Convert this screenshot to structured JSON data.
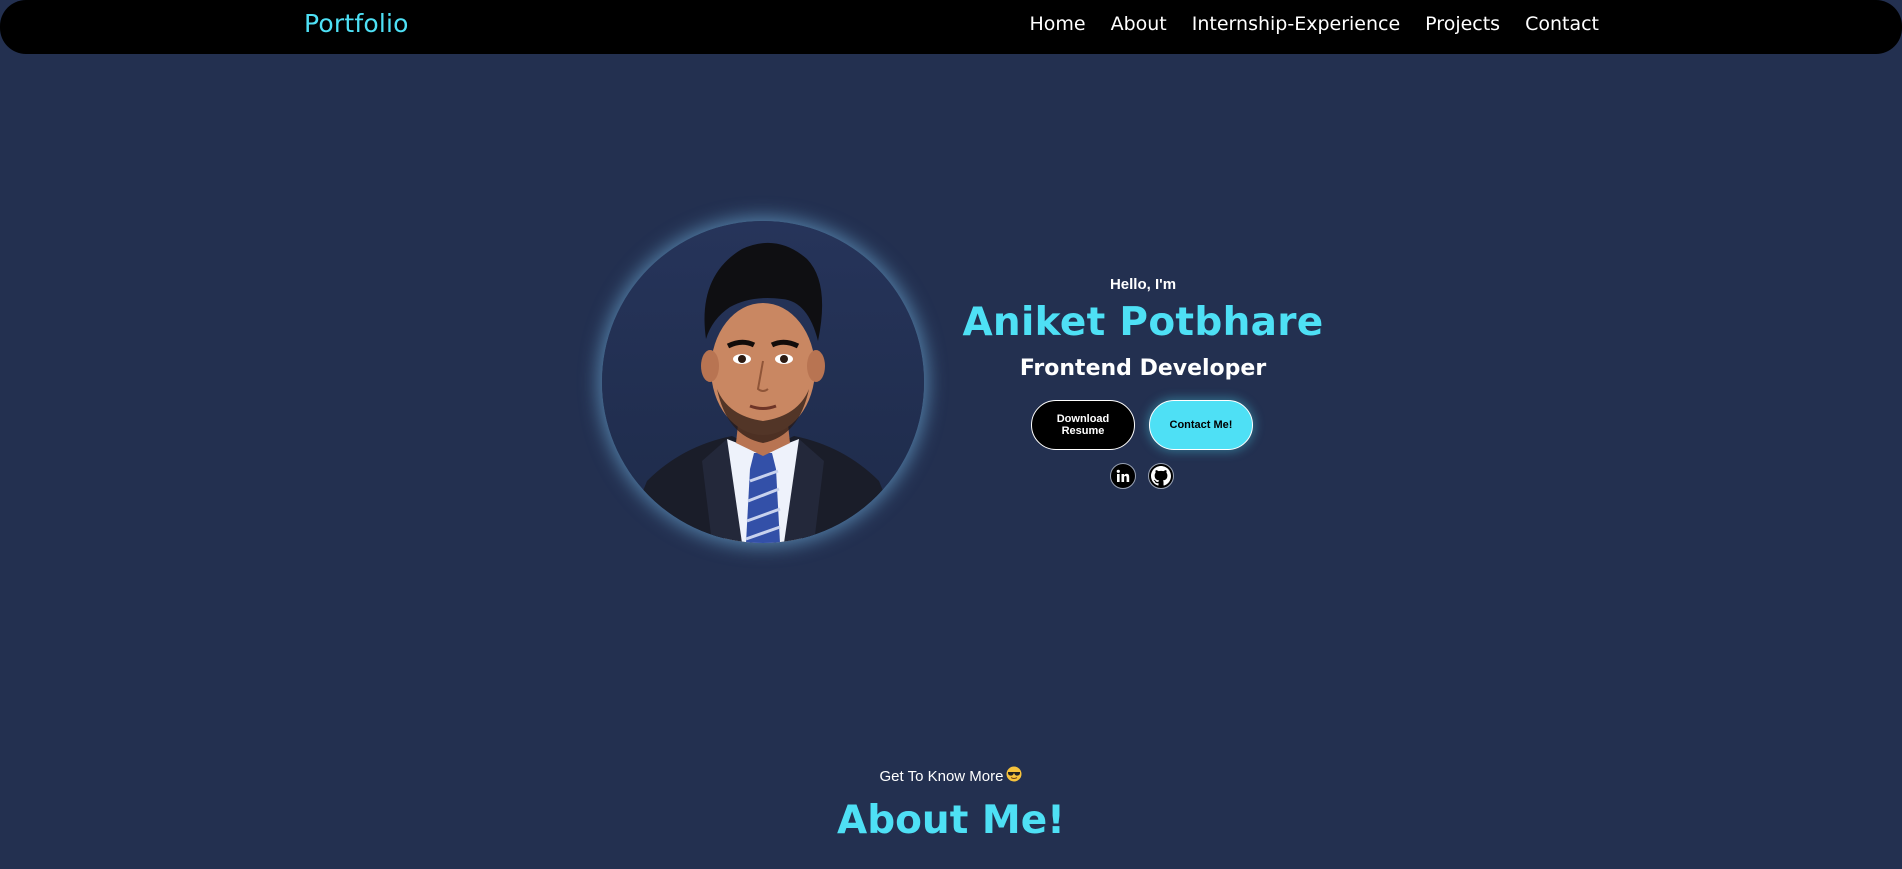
{
  "nav": {
    "brand": "Portfolio",
    "links": [
      "Home",
      "About",
      "Internship-Experience",
      "Projects",
      "Contact"
    ]
  },
  "hero": {
    "greeting": "Hello, I'm",
    "name": "Aniket Potbhare",
    "role": "Frontend Developer",
    "download_label": "Download Resume",
    "contact_label": "Contact Me!",
    "socials": [
      "linkedin-icon",
      "github-icon"
    ]
  },
  "about": {
    "subtitle": "Get To Know More",
    "subtitle_icon": "sunglasses-emoji",
    "title": "About Me!"
  },
  "colors": {
    "background": "#233050",
    "accent": "#4ee0f5",
    "navbar": "#000000"
  }
}
